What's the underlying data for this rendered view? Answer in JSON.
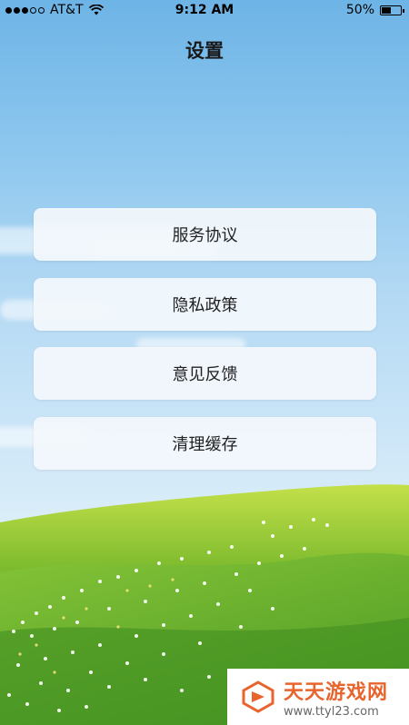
{
  "status_bar": {
    "carrier": "AT&T",
    "time": "9:12 AM",
    "battery_percent": "50%",
    "battery_level": 0.5,
    "signal_icon": "signal-dots-icon",
    "wifi_icon": "wifi-icon",
    "battery_icon": "battery-icon"
  },
  "header": {
    "title": "设置"
  },
  "menu": {
    "items": [
      {
        "label": "服务协议"
      },
      {
        "label": "隐私政策"
      },
      {
        "label": "意见反馈"
      },
      {
        "label": "清理缓存"
      }
    ]
  },
  "watermark": {
    "name": "天天游戏网",
    "url": "www.ttyl23.com",
    "icon": "watermark-logo-icon"
  },
  "colors": {
    "sky_top": "#6db4e6",
    "sky_bottom": "#e6f2fa",
    "grass": "#5aa52a",
    "button_bg": "#f3f8fc",
    "text": "#222222",
    "watermark_orange": "#e8642c"
  }
}
